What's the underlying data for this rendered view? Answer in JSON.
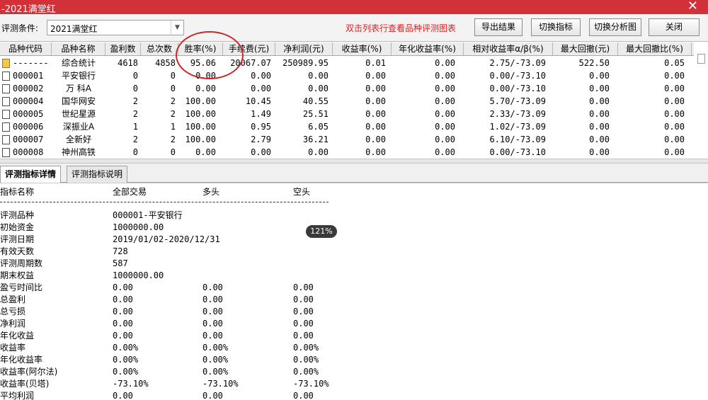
{
  "window": {
    "title": "-2021满堂红",
    "close_glyph": "✕"
  },
  "toolbar": {
    "condition_label": "评测条件:",
    "condition_value": "2021满堂红",
    "hint": "双击列表行查看品种评测图表",
    "buttons": {
      "export": "导出结果",
      "switch_indicator": "切换指标",
      "switch_chart": "切换分析图",
      "close": "关闭"
    }
  },
  "grid": {
    "headers": [
      "品种代码",
      "品种名称",
      "盈利数",
      "总次数",
      "胜率(%)",
      "手续费(元)",
      "净利润(元)",
      "收益率(%)",
      "年化收益率(%)",
      "相对收益率α/β(%)",
      "最大回撤(元)",
      "最大回撤比(%)"
    ],
    "rows": [
      {
        "icon": "folder-icon",
        "code": "-------",
        "name": "综合统计",
        "wins": "4618",
        "total": "4858",
        "win_rate": "95.06",
        "fee": "20067.07",
        "net": "250989.95",
        "ret": "0.01",
        "annual": "0.00",
        "relative": "2.75/-73.09",
        "maxdd": "522.50",
        "maxdd_ratio": "0.05"
      },
      {
        "icon": "doc-icon",
        "code": "000001",
        "name": "平安银行",
        "wins": "0",
        "total": "0",
        "win_rate": "0.00",
        "fee": "0.00",
        "net": "0.00",
        "ret": "0.00",
        "annual": "0.00",
        "relative": "0.00/-73.10",
        "maxdd": "0.00",
        "maxdd_ratio": "0.00"
      },
      {
        "icon": "doc-icon",
        "code": "000002",
        "name": "万 科A",
        "wins": "0",
        "total": "0",
        "win_rate": "0.00",
        "fee": "0.00",
        "net": "0.00",
        "ret": "0.00",
        "annual": "0.00",
        "relative": "0.00/-73.10",
        "maxdd": "0.00",
        "maxdd_ratio": "0.00"
      },
      {
        "icon": "doc-icon",
        "code": "000004",
        "name": "国华网安",
        "wins": "2",
        "total": "2",
        "win_rate": "100.00",
        "fee": "10.45",
        "net": "40.55",
        "ret": "0.00",
        "annual": "0.00",
        "relative": "5.70/-73.09",
        "maxdd": "0.00",
        "maxdd_ratio": "0.00"
      },
      {
        "icon": "doc-icon",
        "code": "000005",
        "name": "世纪星源",
        "wins": "2",
        "total": "2",
        "win_rate": "100.00",
        "fee": "1.49",
        "net": "25.51",
        "ret": "0.00",
        "annual": "0.00",
        "relative": "2.33/-73.09",
        "maxdd": "0.00",
        "maxdd_ratio": "0.00"
      },
      {
        "icon": "doc-icon",
        "code": "000006",
        "name": "深振业A",
        "wins": "1",
        "total": "1",
        "win_rate": "100.00",
        "fee": "0.95",
        "net": "6.05",
        "ret": "0.00",
        "annual": "0.00",
        "relative": "1.02/-73.09",
        "maxdd": "0.00",
        "maxdd_ratio": "0.00"
      },
      {
        "icon": "doc-icon",
        "code": "000007",
        "name": "全新好",
        "wins": "2",
        "total": "2",
        "win_rate": "100.00",
        "fee": "2.79",
        "net": "36.21",
        "ret": "0.00",
        "annual": "0.00",
        "relative": "6.10/-73.09",
        "maxdd": "0.00",
        "maxdd_ratio": "0.00"
      },
      {
        "icon": "doc-icon",
        "code": "000008",
        "name": "神州高铁",
        "wins": "0",
        "total": "0",
        "win_rate": "0.00",
        "fee": "0.00",
        "net": "0.00",
        "ret": "0.00",
        "annual": "0.00",
        "relative": "0.00/-73.10",
        "maxdd": "0.00",
        "maxdd_ratio": "0.00"
      }
    ]
  },
  "tabs": {
    "details": "评测指标详情",
    "description": "评测指标说明"
  },
  "details": {
    "headers": [
      "指标名称",
      "全部交易",
      "多头",
      "空头"
    ],
    "rows": [
      [
        "评测品种",
        "000001-平安银行",
        "",
        ""
      ],
      [
        "初始资金",
        "1000000.00",
        "",
        ""
      ],
      [
        "评测日期",
        "2019/01/02-2020/12/31",
        "",
        ""
      ],
      [
        "有效天数",
        "728",
        "",
        ""
      ],
      [
        "评测周期数",
        "587",
        "",
        ""
      ],
      [
        "期末权益",
        "1000000.00",
        "",
        ""
      ],
      [
        "盈亏时间比",
        "0.00",
        "0.00",
        "0.00"
      ],
      [
        "总盈利",
        "0.00",
        "0.00",
        "0.00"
      ],
      [
        "总亏损",
        "0.00",
        "0.00",
        "0.00"
      ],
      [
        "净利润",
        "0.00",
        "0.00",
        "0.00"
      ],
      [
        "年化收益",
        "0.00",
        "0.00",
        "0.00"
      ],
      [
        "收益率",
        "0.00%",
        "0.00%",
        "0.00%"
      ],
      [
        "年化收益率",
        "0.00%",
        "0.00%",
        "0.00%"
      ],
      [
        "收益率(阿尔法)",
        "0.00%",
        "0.00%",
        "0.00%"
      ],
      [
        "收益率(贝塔)",
        "-73.10%",
        "-73.10%",
        "-73.10%"
      ],
      [
        "平均利润",
        "0.00",
        "0.00",
        "0.00"
      ]
    ]
  },
  "zoom_badge": "121%",
  "colors": {
    "titlebar": "#d3313a",
    "hint": "#e0201f",
    "highlight_ring": "#c92828"
  }
}
